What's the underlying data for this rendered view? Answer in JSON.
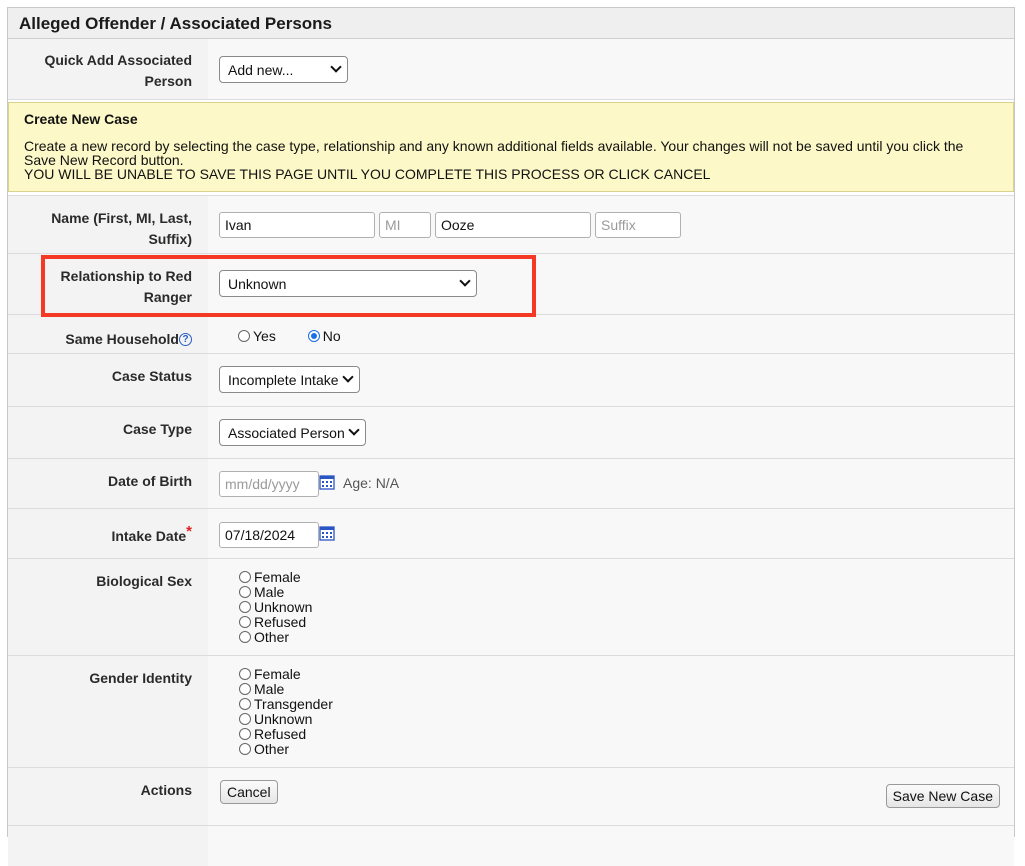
{
  "panel": {
    "title": "Alleged Offender / Associated Persons"
  },
  "quick_add": {
    "label": "Quick Add Associated Person",
    "value": "Add new..."
  },
  "notice": {
    "title": "Create New Case",
    "body": "Create a new record by selecting the case type, relationship and any known additional fields available. Your changes will not be saved until you click the Save New Record button.",
    "warning": "YOU WILL BE UNABLE TO SAVE THIS PAGE UNTIL YOU COMPLETE THIS PROCESS OR CLICK CANCEL"
  },
  "name": {
    "label": "Name (First, MI, Last, Suffix)",
    "first": "Ivan",
    "mi_placeholder": "MI",
    "last": "Ooze",
    "suffix_placeholder": "Suffix"
  },
  "relationship": {
    "label": "Relationship to Red Ranger",
    "value": "Unknown"
  },
  "household": {
    "label": "Same Household",
    "help": "?",
    "options": [
      {
        "label": "Yes",
        "selected": false
      },
      {
        "label": "No",
        "selected": true
      }
    ]
  },
  "case_status": {
    "label": "Case Status",
    "value": "Incomplete Intake"
  },
  "case_type": {
    "label": "Case Type",
    "value": "Associated Person"
  },
  "dob": {
    "label": "Date of Birth",
    "placeholder": "mm/dd/yyyy",
    "age": "Age: N/A"
  },
  "intake": {
    "label": "Intake Date",
    "required": "*",
    "value": "07/18/2024"
  },
  "bio_sex": {
    "label": "Biological Sex",
    "options": [
      "Female",
      "Male",
      "Unknown",
      "Refused",
      "Other"
    ]
  },
  "gender": {
    "label": "Gender Identity",
    "options": [
      "Female",
      "Male",
      "Transgender",
      "Unknown",
      "Refused",
      "Other"
    ]
  },
  "actions": {
    "label": "Actions",
    "cancel": "Cancel",
    "save": "Save New Case"
  },
  "colors": {
    "highlight": "#f43a24",
    "notice_bg": "#fcf8c7",
    "radio_selected": "#1a6ee8"
  }
}
